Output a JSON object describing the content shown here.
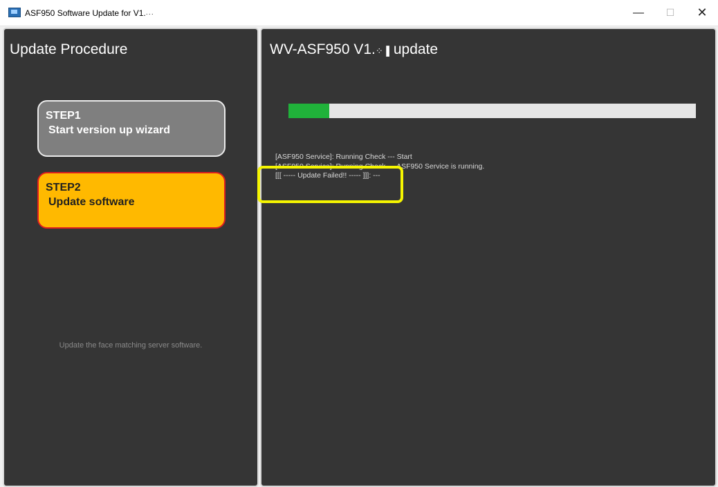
{
  "window": {
    "title": "ASF950 Software Update for V1.",
    "title_glyphs": "···",
    "icon": "app-icon",
    "minimize_glyph": "—",
    "maximize_glyph": "☐",
    "close_glyph": "✕"
  },
  "left_panel": {
    "title": "Update Procedure",
    "steps": [
      {
        "number": "STEP1",
        "label": "Start version up wizard",
        "state": "completed"
      },
      {
        "number": "STEP2",
        "label": "Update software",
        "state": "active"
      }
    ],
    "description": "Update the face matching server software."
  },
  "right_panel": {
    "title_prefix": "WV-ASF950 V1.",
    "title_glyphs": "⁘▐",
    "title_suffix": " update",
    "progress_percent": 10,
    "log": [
      "[ASF950 Service]: Running Check --- Start",
      "[ASF950 Service]: Running Check --- ASF950 Service is running.",
      "[[[ ----- Update Failed!! ----- ]]]:  ---"
    ]
  },
  "colors": {
    "panel_bg": "#353535",
    "step_completed": "#7f7f7f",
    "step_active": "#ffb900",
    "step_active_border": "#e01f1f",
    "progress_fill": "#20b23a",
    "annotation_highlight": "#f5f500"
  }
}
